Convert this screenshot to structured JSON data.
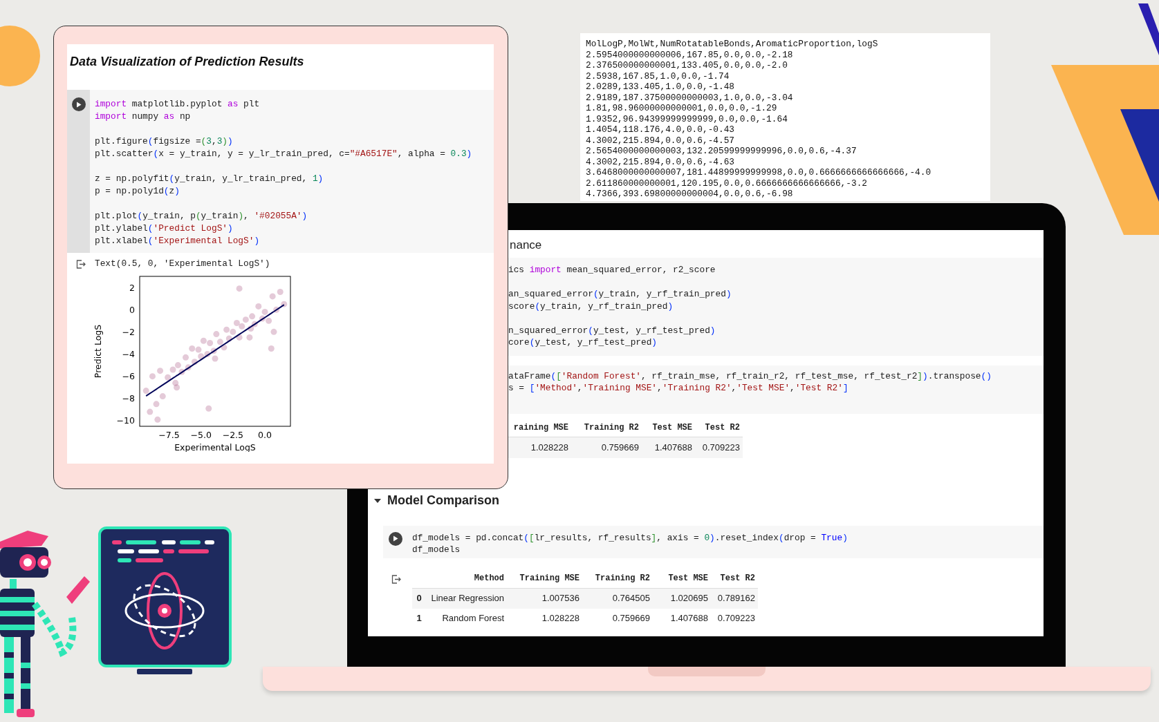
{
  "notebook_card": {
    "title": "Data Visualization of Prediction Results",
    "code_cell": {
      "blocks": [
        [
          [
            {
              "text": "import",
              "kind": "keyword"
            },
            {
              "text": " matplotlib.pyplot ",
              "kind": "plain"
            },
            {
              "text": "as",
              "kind": "keyword"
            },
            {
              "text": " plt",
              "kind": "plain"
            }
          ],
          [
            {
              "text": "import",
              "kind": "keyword"
            },
            {
              "text": " numpy ",
              "kind": "plain"
            },
            {
              "text": "as",
              "kind": "keyword"
            },
            {
              "text": " np",
              "kind": "plain"
            }
          ]
        ],
        [
          [
            {
              "text": "plt.figure",
              "kind": "plain"
            },
            {
              "text": "(",
              "kind": "bracket"
            },
            {
              "text": "figsize =",
              "kind": "plain"
            },
            {
              "text": "(",
              "kind": "bracket2"
            },
            {
              "text": "3",
              "kind": "number"
            },
            {
              "text": ",",
              "kind": "plain"
            },
            {
              "text": "3",
              "kind": "number"
            },
            {
              "text": ")",
              "kind": "bracket2"
            },
            {
              "text": ")",
              "kind": "bracket"
            }
          ],
          [
            {
              "text": "plt.scatter",
              "kind": "plain"
            },
            {
              "text": "(",
              "kind": "bracket"
            },
            {
              "text": "x = y_train, y = y_lr_train_pred, c=",
              "kind": "plain"
            },
            {
              "text": "\"#A6517E\"",
              "kind": "string"
            },
            {
              "text": ", alpha = ",
              "kind": "plain"
            },
            {
              "text": "0.3",
              "kind": "number"
            },
            {
              "text": ")",
              "kind": "bracket"
            }
          ]
        ],
        [
          [
            {
              "text": "z = np.polyfit",
              "kind": "plain"
            },
            {
              "text": "(",
              "kind": "bracket"
            },
            {
              "text": "y_train, y_lr_train_pred, ",
              "kind": "plain"
            },
            {
              "text": "1",
              "kind": "number"
            },
            {
              "text": ")",
              "kind": "bracket"
            }
          ],
          [
            {
              "text": "p = np.poly1d",
              "kind": "plain"
            },
            {
              "text": "(",
              "kind": "bracket"
            },
            {
              "text": "z",
              "kind": "plain"
            },
            {
              "text": ")",
              "kind": "bracket"
            }
          ]
        ],
        [
          [
            {
              "text": "plt.plot",
              "kind": "plain"
            },
            {
              "text": "(",
              "kind": "bracket"
            },
            {
              "text": "y_train, p",
              "kind": "plain"
            },
            {
              "text": "(",
              "kind": "bracket2"
            },
            {
              "text": "y_train",
              "kind": "plain"
            },
            {
              "text": ")",
              "kind": "bracket2"
            },
            {
              "text": ", ",
              "kind": "plain"
            },
            {
              "text": "'#02055A'",
              "kind": "string"
            },
            {
              "text": ")",
              "kind": "bracket"
            }
          ],
          [
            {
              "text": "plt.ylabel",
              "kind": "plain"
            },
            {
              "text": "(",
              "kind": "bracket"
            },
            {
              "text": "'Predict LogS'",
              "kind": "string"
            },
            {
              "text": ")",
              "kind": "bracket"
            }
          ],
          [
            {
              "text": "plt.xlabel",
              "kind": "plain"
            },
            {
              "text": "(",
              "kind": "bracket"
            },
            {
              "text": "'Experimental LogS'",
              "kind": "string"
            },
            {
              "text": ")",
              "kind": "bracket"
            }
          ]
        ]
      ]
    },
    "output": {
      "text": "Text(0.5, 0, 'Experimental LogS')",
      "chart_data": {
        "type": "scatter",
        "xlabel": "Experimental LogS",
        "ylabel": "Predict LogS",
        "xlim": [
          -9.8,
          2.0
        ],
        "ylim": [
          -10.5,
          3.0
        ],
        "xticks": [
          {
            "value": -7.5,
            "label": "−7.5"
          },
          {
            "value": -5,
            "label": "−5.0"
          },
          {
            "value": -2.5,
            "label": "−2.5"
          },
          {
            "value": 0,
            "label": "0.0"
          }
        ],
        "yticks": [
          {
            "value": 2,
            "label": "2"
          },
          {
            "value": 0,
            "label": "0"
          },
          {
            "value": -2,
            "label": "−2"
          },
          {
            "value": -4,
            "label": "−4"
          },
          {
            "value": -6,
            "label": "−6"
          },
          {
            "value": -8,
            "label": "−8"
          },
          {
            "value": -10,
            "label": "−10"
          }
        ],
        "x": [
          -9.3,
          -9.0,
          -8.8,
          -8.5,
          -8.2,
          -8.0,
          -7.6,
          -7.2,
          -7.0,
          -6.8,
          -6.5,
          -6.2,
          -6.0,
          -5.7,
          -5.5,
          -5.2,
          -5.0,
          -4.8,
          -4.5,
          -4.3,
          -4.0,
          -3.8,
          -3.5,
          -3.2,
          -3.0,
          -2.8,
          -2.5,
          -2.2,
          -2.0,
          -1.8,
          -1.5,
          -1.2,
          -1.0,
          -0.8,
          -0.5,
          -0.2,
          0.0,
          0.3,
          0.6,
          0.9,
          1.2,
          1.5,
          -4.4,
          -2.0,
          0.5,
          -8.4,
          -6.9,
          -3.9,
          -1.1,
          0.7
        ],
        "series": [
          {
            "type": "scatter",
            "color": "#a6517e",
            "values": [
              -7.3,
              -9.2,
              -6.0,
              -8.5,
              -5.5,
              -7.8,
              -6.1,
              -5.4,
              -6.6,
              -5.0,
              -5.6,
              -4.3,
              -5.2,
              -3.5,
              -4.7,
              -3.6,
              -4.2,
              -2.8,
              -4.0,
              -3.0,
              -3.7,
              -2.2,
              -2.9,
              -3.4,
              -1.8,
              -2.6,
              -2.0,
              -1.2,
              -2.5,
              -1.5,
              -0.9,
              -2.5,
              -0.6,
              -1.3,
              0.3,
              -0.8,
              -0.2,
              -1.0,
              1.2,
              0.0,
              1.6,
              0.5,
              -8.9,
              1.9,
              -3.5,
              -9.9,
              -7.0,
              -4.4,
              -1.7,
              -2.0
            ]
          },
          {
            "type": "line",
            "color": "#02055a",
            "values": [
              -7.77,
              -7.54,
              -7.39,
              -7.16,
              -6.93,
              -6.78,
              -6.48,
              -6.17,
              -6.02,
              -5.87,
              -5.64,
              -5.41,
              -5.26,
              -5.03,
              -4.88,
              -4.65,
              -4.5,
              -4.35,
              -4.12,
              -3.97,
              -3.74,
              -3.59,
              -3.36,
              -3.13,
              -2.98,
              -2.83,
              -2.6,
              -2.37,
              -2.22,
              -2.07,
              -1.84,
              -1.61,
              -1.46,
              -1.31,
              -1.08,
              -0.85,
              -0.7,
              -0.47,
              -0.24,
              -0.02,
              0.21,
              0.44,
              -4.04,
              -2.22,
              -0.32,
              -7.08,
              -5.94,
              -3.66,
              -1.54,
              -0.17
            ]
          }
        ]
      }
    }
  },
  "csv_panel": {
    "lines": [
      "MolLogP,MolWt,NumRotatableBonds,AromaticProportion,logS",
      "2.5954000000000006,167.85,0.0,0.0,-2.18",
      "2.376500000000001,133.405,0.0,0.0,-2.0",
      "2.5938,167.85,1.0,0.0,-1.74",
      "2.0289,133.405,1.0,0.0,-1.48",
      "2.9189,187.37500000000003,1.0,0.0,-3.04",
      "1.81,98.96000000000001,0.0,0.0,-1.29",
      "1.9352,96.94399999999999,0.0,0.0,-1.64",
      "1.4054,118.176,4.0,0.0,-0.43",
      "4.3002,215.894,0.0,0.6,-4.57",
      "2.5654000000000003,132.20599999999996,0.0,0.6,-4.37",
      "4.3002,215.894,0.0,0.6,-4.63",
      "3.6468000000000007,181.44899999999998,0.0,0.6666666666666666,-4.0",
      "2.611860000000001,120.195,0.0,0.6666666666666666,-3.2",
      "4.7366,393.69800000000004,0.0,0.6,-6.98"
    ]
  },
  "laptop_notebook": {
    "section_heading": "nance",
    "code_cells": [
      {
        "blocks": [
          [
            [
              {
                "text": "ics ",
                "kind": "plain"
              },
              {
                "text": "import",
                "kind": "keyword"
              },
              {
                "text": " mean_squared_error, r2_score",
                "kind": "plain"
              }
            ]
          ],
          [
            [
              {
                "text": "an_squared_error",
                "kind": "plain"
              },
              {
                "text": "(",
                "kind": "bracket"
              },
              {
                "text": "y_train, y_rf_train_pred",
                "kind": "plain"
              },
              {
                "text": ")",
                "kind": "bracket"
              }
            ],
            [
              {
                "text": "score",
                "kind": "plain"
              },
              {
                "text": "(",
                "kind": "bracket"
              },
              {
                "text": "y_train, y_rf_train_pred",
                "kind": "plain"
              },
              {
                "text": ")",
                "kind": "bracket"
              }
            ]
          ],
          [
            [
              {
                "text": "n_squared_error",
                "kind": "plain"
              },
              {
                "text": "(",
                "kind": "bracket"
              },
              {
                "text": "y_test, y_rf_test_pred",
                "kind": "plain"
              },
              {
                "text": ")",
                "kind": "bracket"
              }
            ],
            [
              {
                "text": "core",
                "kind": "plain"
              },
              {
                "text": "(",
                "kind": "bracket"
              },
              {
                "text": "y_test, y_rf_test_pred",
                "kind": "plain"
              },
              {
                "text": ")",
                "kind": "bracket"
              }
            ]
          ]
        ]
      },
      {
        "blocks": [
          [
            [
              {
                "text": "ataFrame",
                "kind": "plain"
              },
              {
                "text": "(",
                "kind": "bracket"
              },
              {
                "text": "[",
                "kind": "bracket2"
              },
              {
                "text": "'Random Forest'",
                "kind": "string"
              },
              {
                "text": ", rf_train_mse, rf_train_r2, rf_test_mse, rf_test_r2",
                "kind": "plain"
              },
              {
                "text": "]",
                "kind": "bracket2"
              },
              {
                "text": ")",
                "kind": "bracket"
              },
              {
                "text": ".transpose",
                "kind": "plain"
              },
              {
                "text": "()",
                "kind": "bracket"
              }
            ],
            [
              {
                "text": "s = ",
                "kind": "plain"
              },
              {
                "text": "[",
                "kind": "bracket"
              },
              {
                "text": "'Method'",
                "kind": "string"
              },
              {
                "text": ",",
                "kind": "plain"
              },
              {
                "text": "'Training MSE'",
                "kind": "string"
              },
              {
                "text": ",",
                "kind": "plain"
              },
              {
                "text": "'Training R2'",
                "kind": "string"
              },
              {
                "text": ",",
                "kind": "plain"
              },
              {
                "text": "'Test MSE'",
                "kind": "string"
              },
              {
                "text": ",",
                "kind": "plain"
              },
              {
                "text": "'Test R2'",
                "kind": "string"
              },
              {
                "text": "]",
                "kind": "bracket"
              }
            ]
          ]
        ]
      }
    ],
    "results_table": {
      "columns": [
        "raining MSE",
        "Training R2",
        "Test MSE",
        "Test R2"
      ],
      "rows": [
        [
          "1.028228",
          "0.759669",
          "1.407688",
          "0.709223"
        ]
      ]
    },
    "model_comparison": {
      "heading": "Model Comparison",
      "expanded": true,
      "code_cell": {
        "blocks": [
          [
            [
              {
                "text": "df_models = pd.concat",
                "kind": "plain"
              },
              {
                "text": "(",
                "kind": "bracket"
              },
              {
                "text": "[",
                "kind": "bracket2"
              },
              {
                "text": "lr_results, rf_results",
                "kind": "plain"
              },
              {
                "text": "]",
                "kind": "bracket2"
              },
              {
                "text": ", axis = ",
                "kind": "plain"
              },
              {
                "text": "0",
                "kind": "number"
              },
              {
                "text": ")",
                "kind": "bracket"
              },
              {
                "text": ".reset_index",
                "kind": "plain"
              },
              {
                "text": "(",
                "kind": "bracket"
              },
              {
                "text": "drop = ",
                "kind": "plain"
              },
              {
                "text": "True",
                "kind": "constant"
              },
              {
                "text": ")",
                "kind": "bracket"
              }
            ],
            [
              {
                "text": "df_models",
                "kind": "plain"
              }
            ]
          ]
        ]
      },
      "table": {
        "columns": [
          "Method",
          "Training MSE",
          "Training R2",
          "Test MSE",
          "Test R2"
        ],
        "rows": [
          {
            "index": "0",
            "cells": [
              "Linear Regression",
              "1.007536",
              "0.764505",
              "1.020695",
              "0.789162"
            ]
          },
          {
            "index": "1",
            "cells": [
              "Random Forest",
              "1.028228",
              "0.759669",
              "1.407688",
              "0.709223"
            ]
          }
        ]
      }
    }
  }
}
